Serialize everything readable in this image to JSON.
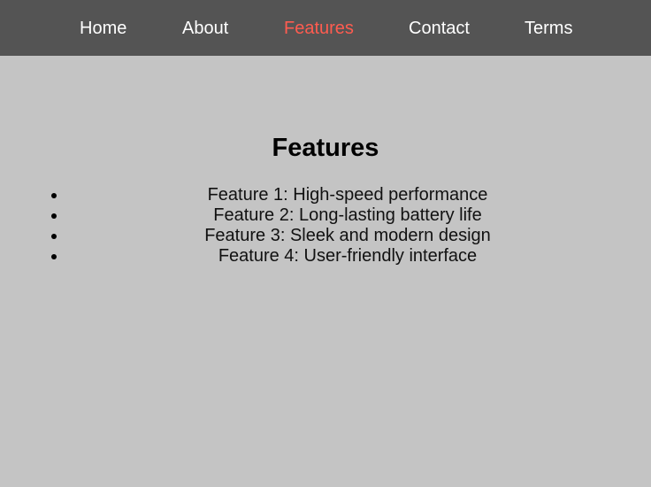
{
  "nav": {
    "items": [
      {
        "label": "Home",
        "active": false
      },
      {
        "label": "About",
        "active": false
      },
      {
        "label": "Features",
        "active": true
      },
      {
        "label": "Contact",
        "active": false
      },
      {
        "label": "Terms",
        "active": false
      }
    ],
    "background_color": "#545454",
    "text_color": "#ffffff",
    "active_color": "#ff5c50"
  },
  "main": {
    "title": "Features",
    "background_color": "#c4c4c4",
    "features": [
      "Feature 1: High-speed performance",
      "Feature 2: Long-lasting battery life",
      "Feature 3: Sleek and modern design",
      "Feature 4: User-friendly interface"
    ]
  }
}
